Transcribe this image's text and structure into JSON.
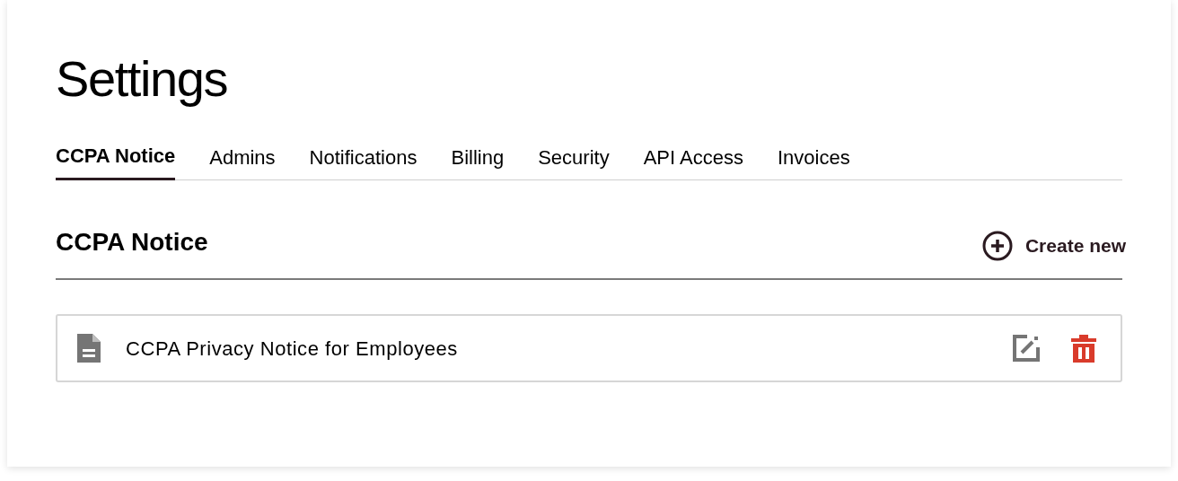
{
  "page": {
    "title": "Settings"
  },
  "tabs": [
    {
      "label": "CCPA Notice",
      "selected": true
    },
    {
      "label": "Admins",
      "selected": false
    },
    {
      "label": "Notifications",
      "selected": false
    },
    {
      "label": "Billing",
      "selected": false
    },
    {
      "label": "Security",
      "selected": false
    },
    {
      "label": "API Access",
      "selected": false
    },
    {
      "label": "Invoices",
      "selected": false
    }
  ],
  "section": {
    "title": "CCPA Notice",
    "create_button": "Create new"
  },
  "notices": [
    {
      "title": "CCPA Privacy Notice for Employees"
    }
  ]
}
